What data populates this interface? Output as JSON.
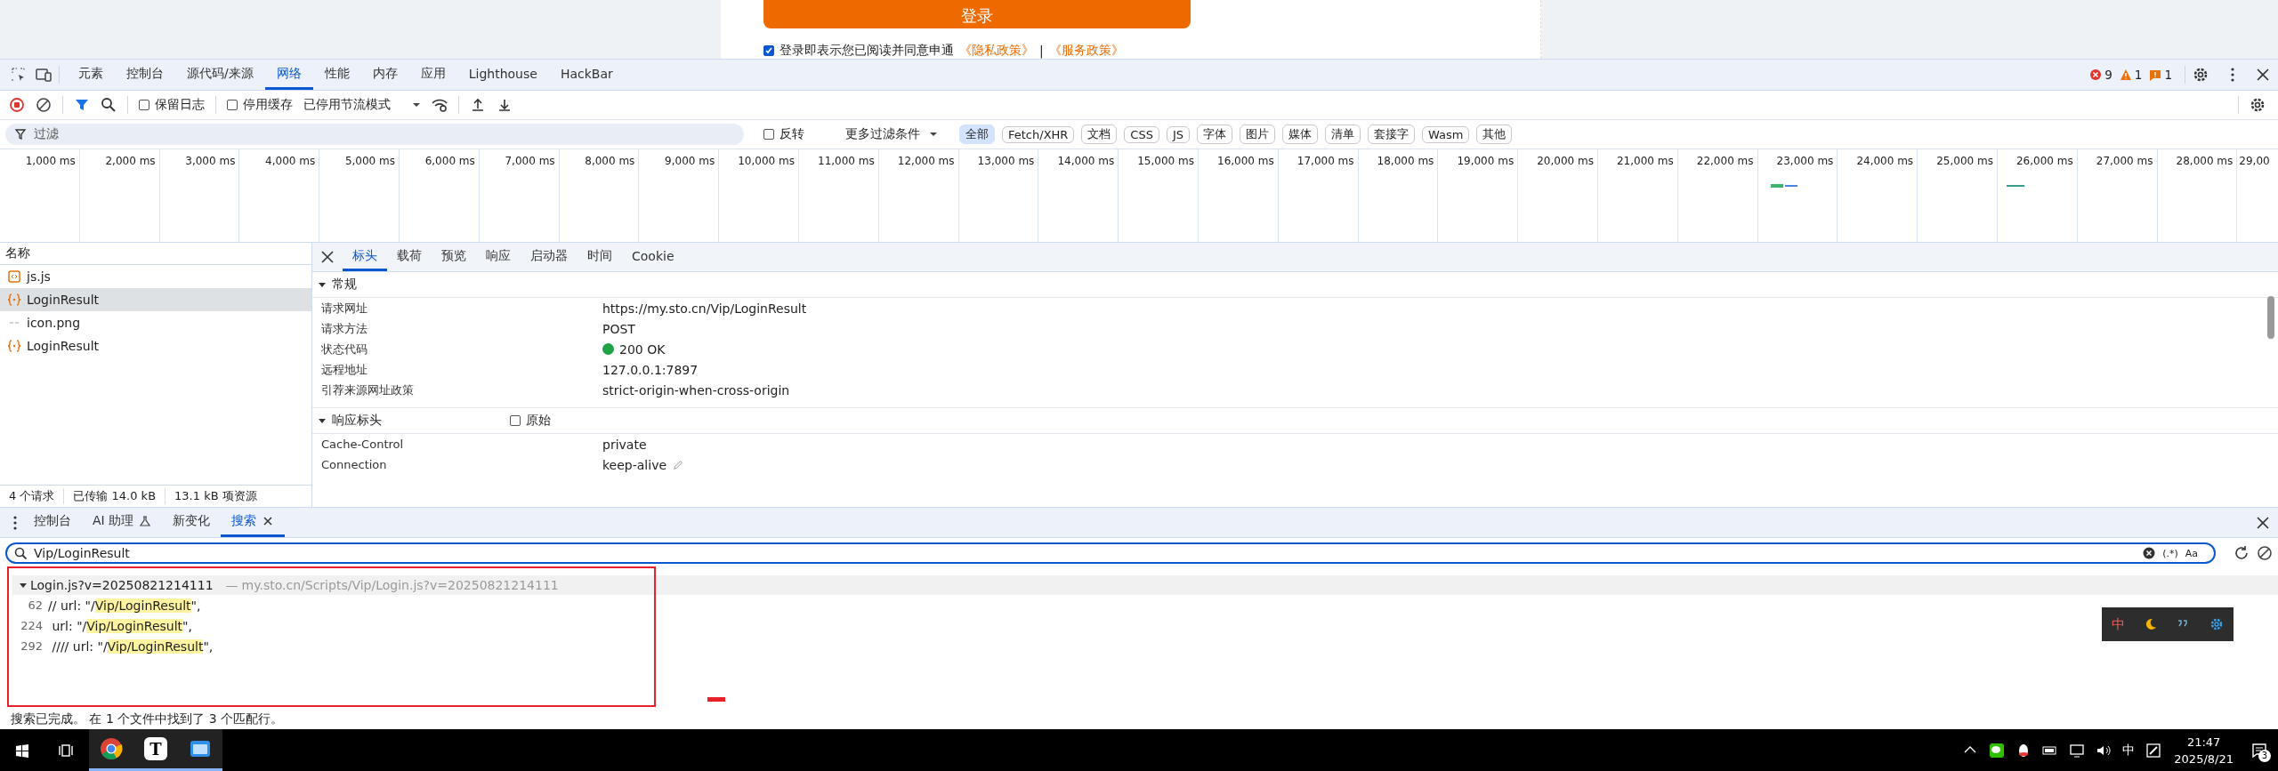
{
  "page": {
    "login_button": "登录",
    "agree_checked": true,
    "agree_text": "登录即表示您已阅读并同意申通",
    "privacy_link": "《隐私政策》",
    "separator": "|",
    "service_link": "《服务政策》"
  },
  "devtools": {
    "tabs": [
      {
        "label": "元素",
        "selected": false
      },
      {
        "label": "控制台",
        "selected": false
      },
      {
        "label": "源代码/来源",
        "selected": false
      },
      {
        "label": "网络",
        "selected": true
      },
      {
        "label": "性能",
        "selected": false
      },
      {
        "label": "内存",
        "selected": false
      },
      {
        "label": "应用",
        "selected": false
      },
      {
        "label": "Lighthouse",
        "selected": false
      },
      {
        "label": "HackBar",
        "selected": false
      }
    ],
    "issues": {
      "errors": "9",
      "warnings": "1",
      "info": "1"
    }
  },
  "toolbar": {
    "preserve_log": {
      "label": "保留日志",
      "checked": false
    },
    "disable_cache": {
      "label": "停用缓存",
      "checked": false
    },
    "throttling": "已停用节流模式"
  },
  "filter": {
    "placeholder": "过滤",
    "invert": {
      "label": "反转",
      "checked": false
    },
    "more_filters": "更多过滤条件",
    "types": [
      {
        "label": "全部",
        "selected": true
      },
      {
        "label": "Fetch/XHR",
        "selected": false
      },
      {
        "label": "文档",
        "selected": false
      },
      {
        "label": "CSS",
        "selected": false
      },
      {
        "label": "JS",
        "selected": false
      },
      {
        "label": "字体",
        "selected": false
      },
      {
        "label": "图片",
        "selected": false
      },
      {
        "label": "媒体",
        "selected": false
      },
      {
        "label": "清单",
        "selected": false
      },
      {
        "label": "套接字",
        "selected": false
      },
      {
        "label": "Wasm",
        "selected": false
      },
      {
        "label": "其他",
        "selected": false
      }
    ]
  },
  "timeline": {
    "ticks": [
      "1,000 ms",
      "2,000 ms",
      "3,000 ms",
      "4,000 ms",
      "5,000 ms",
      "6,000 ms",
      "7,000 ms",
      "8,000 ms",
      "9,000 ms",
      "10,000 ms",
      "11,000 ms",
      "12,000 ms",
      "13,000 ms",
      "14,000 ms",
      "15,000 ms",
      "16,000 ms",
      "17,000 ms",
      "18,000 ms",
      "19,000 ms",
      "20,000 ms",
      "21,000 ms",
      "22,000 ms",
      "23,000 ms",
      "24,000 ms",
      "25,000 ms",
      "26,000 ms",
      "27,000 ms",
      "28,000 ms",
      "29,00"
    ]
  },
  "requests": {
    "header": "名称",
    "items": [
      {
        "name": "js.js",
        "kind": "script",
        "selected": false
      },
      {
        "name": "LoginResult",
        "kind": "fetch",
        "selected": true
      },
      {
        "name": "icon.png",
        "kind": "image",
        "selected": false
      },
      {
        "name": "LoginResult",
        "kind": "fetch",
        "selected": false
      }
    ],
    "summary": [
      "4 个请求",
      "已传输 14.0 kB",
      "13.1 kB 项资源"
    ]
  },
  "details": {
    "tabs": [
      {
        "label": "标头",
        "selected": true
      },
      {
        "label": "载荷",
        "selected": false
      },
      {
        "label": "预览",
        "selected": false
      },
      {
        "label": "响应",
        "selected": false
      },
      {
        "label": "启动器",
        "selected": false
      },
      {
        "label": "时间",
        "selected": false
      },
      {
        "label": "Cookie",
        "selected": false
      }
    ],
    "general": {
      "title": "常规",
      "expanded": true,
      "rows": [
        {
          "key": "请求网址",
          "value": "https://my.sto.cn/Vip/LoginResult",
          "kind": "text"
        },
        {
          "key": "请求方法",
          "value": "POST",
          "kind": "text"
        },
        {
          "key": "状态代码",
          "value": "200 OK",
          "kind": "status",
          "color": "#1ea446"
        },
        {
          "key": "远程地址",
          "value": "127.0.0.1:7897",
          "kind": "text"
        },
        {
          "key": "引荐来源网址政策",
          "value": "strict-origin-when-cross-origin",
          "kind": "text"
        }
      ]
    },
    "response_headers": {
      "title": "响应标头",
      "expanded": true,
      "raw": {
        "label": "原始",
        "checked": false
      },
      "rows": [
        {
          "key": "Cache-Control",
          "value": "private",
          "kind": "text"
        },
        {
          "key": "Connection",
          "value": "keep-alive",
          "kind": "editable"
        }
      ]
    }
  },
  "drawer": {
    "tabs": [
      {
        "label": "控制台",
        "selected": false,
        "kind": "plain"
      },
      {
        "label": "AI 助理",
        "selected": false,
        "kind": "lab"
      },
      {
        "label": "新变化",
        "selected": false,
        "kind": "plain"
      },
      {
        "label": "搜索",
        "selected": true,
        "kind": "closable"
      }
    ],
    "search": {
      "value": "Vip/LoginResult",
      "regex": "(.*)",
      "match_case": "Aa"
    },
    "result": {
      "file": "Login.js?v=20250821214111",
      "url_separator": "—",
      "url": "my.sto.cn/Scripts/Vip/Login.js?v=20250821214111",
      "expanded": true,
      "lines": [
        {
          "number": "62",
          "before": "// url: \"/",
          "match": "Vip/LoginResult",
          "after": "\","
        },
        {
          "number": "224",
          "before": " url: \"/",
          "match": "Vip/LoginResult",
          "after": "\","
        },
        {
          "number": "292",
          "before": " //// url: \"/",
          "match": "Vip/LoginResult",
          "after": "\","
        }
      ]
    },
    "status": "搜索已完成。 在 1 个文件中找到了 3 个匹配行。"
  },
  "ime_toolbar": {
    "mode": "中"
  },
  "taskbar": {
    "apps": [
      {
        "kind": "chrome",
        "selected": true
      },
      {
        "kind": "text",
        "glyph": "T",
        "selected": true
      },
      {
        "kind": "files",
        "selected": true
      }
    ],
    "ime": "中",
    "time": "21:47",
    "date": "2025/8/21",
    "notifications": "3"
  }
}
